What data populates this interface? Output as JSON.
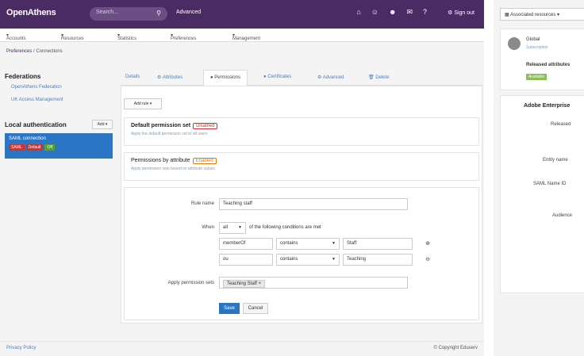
{
  "header": {
    "logo": "OpenAthens",
    "search_placeholder": "Search...",
    "advanced": "Advanced",
    "signout": "Sign out",
    "icons": [
      "home-icon",
      "user-icon",
      "users-icon",
      "chat-icon",
      "help-icon"
    ]
  },
  "menu": [
    "Accounts",
    "Resources",
    "Statistics",
    "Preferences",
    "Management"
  ],
  "breadcrumb": {
    "root": "Preferences",
    "current": "Connections"
  },
  "sidebar": {
    "federations_heading": "Federations",
    "federation_links": [
      "OpenAthens Federation",
      "UK Access Management"
    ],
    "local_heading": "Local authentication",
    "add_label": "Add",
    "active_item": {
      "name": "SAML connection",
      "badges": [
        {
          "label": "SAML",
          "color": "#cc3333"
        },
        {
          "label": "Default",
          "color": "#cc3333"
        },
        {
          "label": "Off",
          "color": "#5aa02c"
        }
      ]
    }
  },
  "tabs": [
    {
      "label": "Details",
      "active": false
    },
    {
      "label": "Attributes",
      "active": false
    },
    {
      "label": "Permissions",
      "active": true
    },
    {
      "label": "Certificates",
      "active": false
    },
    {
      "label": "Advanced",
      "active": false
    },
    {
      "label": "Delete",
      "active": false
    }
  ],
  "filter_label": "Add rule",
  "rules": [
    {
      "title": "Default permission set",
      "flag": "Disabled",
      "sub": "Apply the default permission set to all users"
    },
    {
      "title": "Permissions by attribute",
      "flag": "Enabled",
      "sub": "Apply permission sets based on attribute values"
    }
  ],
  "form": {
    "rule_name_label": "Rule name",
    "rule_name_value": "Teaching staff",
    "when_label": "When",
    "when_select": "all",
    "when_text": "of the following conditions are met",
    "conditions": [
      {
        "attribute": "memberOf",
        "operator": "contains",
        "value": "Staff"
      },
      {
        "attribute": "ou",
        "operator": "contains",
        "value": "Teaching"
      }
    ],
    "apply_label": "Apply permission sets",
    "permission_tag": "Teaching Staff",
    "save_label": "Save",
    "cancel_label": "Cancel"
  },
  "footer": {
    "privacy": "Privacy Policy",
    "copyright": "© Copyright Eduserv"
  },
  "right_panel": {
    "assoc_button": "Associated resources",
    "entity_name": "Global",
    "entity_sub": "Subscription",
    "released_label": "Released attributes",
    "tag": "Available",
    "adobe_heading": "Adobe Enterprise",
    "labels": [
      "Released",
      "Entity name",
      "SAML Name ID",
      "Audience"
    ]
  }
}
